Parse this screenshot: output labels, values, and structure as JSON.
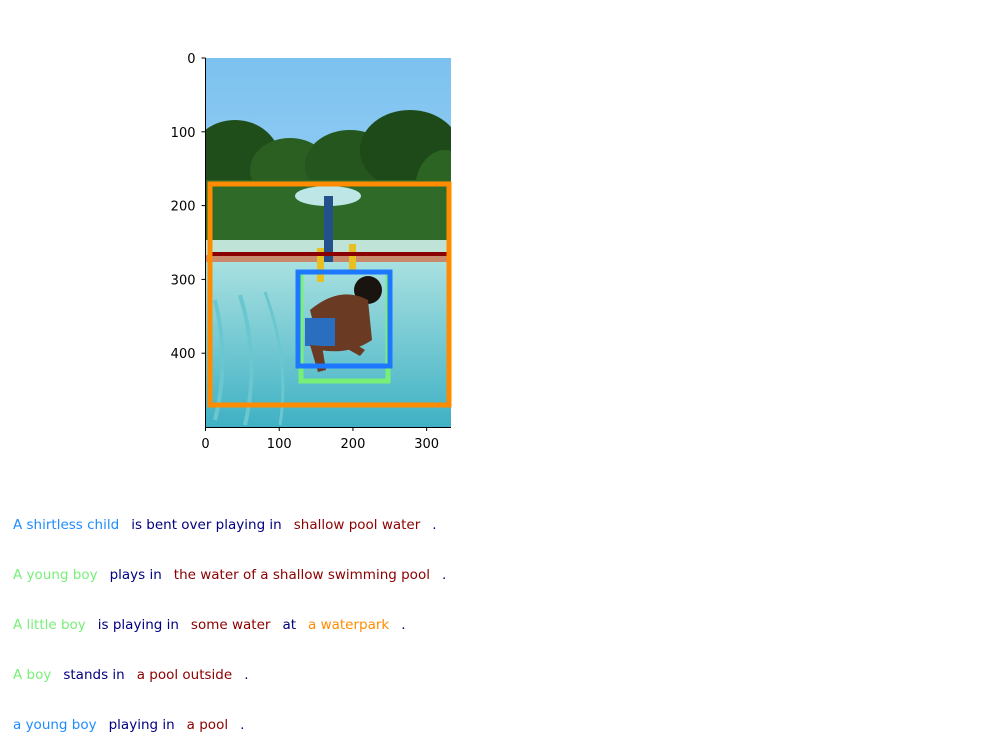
{
  "figure": {
    "colors": {
      "box_orange": "#ff8c00",
      "box_blue": "#1e78ff",
      "box_green": "#78f078",
      "box_darkred": "#8b0000",
      "box_navy": "#00205a"
    },
    "axes": {
      "xlim": [
        0,
        333
      ],
      "ylim": [
        500,
        0
      ],
      "x_ticks": [
        0,
        100,
        200,
        300
      ],
      "y_ticks": [
        0,
        100,
        200,
        300,
        400
      ],
      "grid": false
    },
    "image": {
      "description_icon": "photo-of-child-in-pool"
    }
  },
  "captions": [
    {
      "segments": [
        {
          "text": "A shirtless child",
          "color": "#1e8cff"
        },
        {
          "text": "is bent over playing in",
          "color": "#000080"
        },
        {
          "text": "shallow pool water",
          "color": "#8b0000"
        },
        {
          "text": ".",
          "color": "#000080"
        }
      ]
    },
    {
      "segments": [
        {
          "text": "A young boy",
          "color": "#78f078"
        },
        {
          "text": "plays in",
          "color": "#000080"
        },
        {
          "text": "the water of a shallow swimming pool",
          "color": "#8b0000"
        },
        {
          "text": ".",
          "color": "#000080"
        }
      ]
    },
    {
      "segments": [
        {
          "text": "A little boy",
          "color": "#78f078"
        },
        {
          "text": "is playing in",
          "color": "#000080"
        },
        {
          "text": "some water",
          "color": "#8b0000"
        },
        {
          "text": "at",
          "color": "#000080"
        },
        {
          "text": "a waterpark",
          "color": "#ff8c00"
        },
        {
          "text": ".",
          "color": "#000080"
        }
      ]
    },
    {
      "segments": [
        {
          "text": "A boy",
          "color": "#78f078"
        },
        {
          "text": "stands in",
          "color": "#000080"
        },
        {
          "text": "a pool outside",
          "color": "#8b0000"
        },
        {
          "text": ".",
          "color": "#000080"
        }
      ]
    },
    {
      "segments": [
        {
          "text": "a young boy",
          "color": "#1e8cff"
        },
        {
          "text": "playing in",
          "color": "#000080"
        },
        {
          "text": "a pool",
          "color": "#8b0000"
        },
        {
          "text": ".",
          "color": "#000080"
        }
      ]
    }
  ]
}
